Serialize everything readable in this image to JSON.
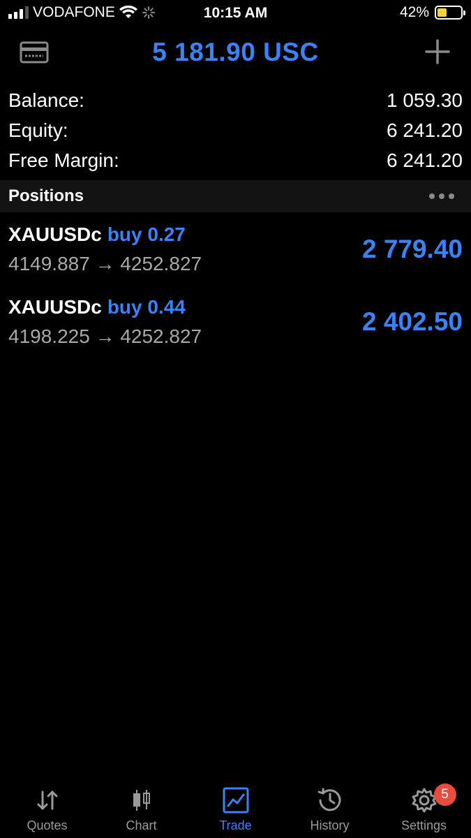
{
  "status_bar": {
    "carrier": "VODAFONE",
    "time": "10:15 AM",
    "battery": "42%",
    "battery_level": 0.42,
    "battery_color": "#f5d23c"
  },
  "header": {
    "title": "5 181.90 USC",
    "left_icon": "wallet-icon",
    "right_icon": "plus-icon"
  },
  "account": {
    "balance_label": "Balance:",
    "balance_value": "1 059.30",
    "equity_label": "Equity:",
    "equity_value": "6 241.20",
    "free_margin_label": "Free Margin:",
    "free_margin_value": "6 241.20"
  },
  "positions": {
    "title": "Positions",
    "items": [
      {
        "symbol": "XAUUSDc",
        "side": "buy 0.27",
        "prices": "4149.887 → 4252.827",
        "profit": "2 779.40"
      },
      {
        "symbol": "XAUUSDc",
        "side": "buy 0.44",
        "prices": "4198.225 → 4252.827",
        "profit": "2 402.50"
      }
    ]
  },
  "tabs": [
    {
      "label": "Quotes",
      "icon": "quotes-icon"
    },
    {
      "label": "Chart",
      "icon": "chart-icon"
    },
    {
      "label": "Trade",
      "icon": "trade-icon",
      "active": true
    },
    {
      "label": "History",
      "icon": "history-icon"
    },
    {
      "label": "Settings",
      "icon": "settings-icon",
      "badge": "5"
    }
  ],
  "colors": {
    "accent": "#3b82f6",
    "background": "#000000",
    "badge": "#e74c3c"
  }
}
